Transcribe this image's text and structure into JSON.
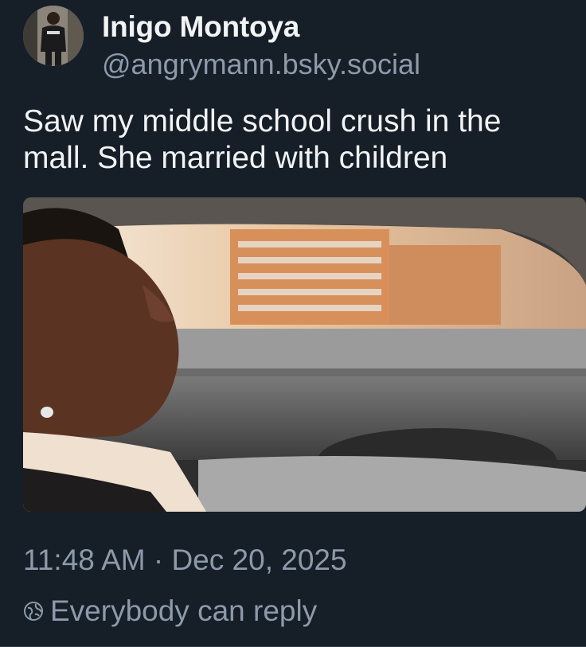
{
  "author": {
    "display_name": "Inigo Montoya",
    "handle": "@angrymann.bsky.social"
  },
  "post": {
    "text_lines": [
      "Saw my middle school crush in the",
      "mall. She married with children"
    ],
    "timestamp": "11:48 AM · Dec 20, 2025",
    "reply_setting": "Everybody can reply",
    "media": {
      "type": "gif",
      "description": "man in turtleneck driving a car looking out the side window"
    }
  },
  "icons": {
    "reply_setting": "globe-icon"
  },
  "colors": {
    "background": "#161e27",
    "primary_text": "#f1f3f5",
    "secondary_text": "#8c9aab"
  }
}
